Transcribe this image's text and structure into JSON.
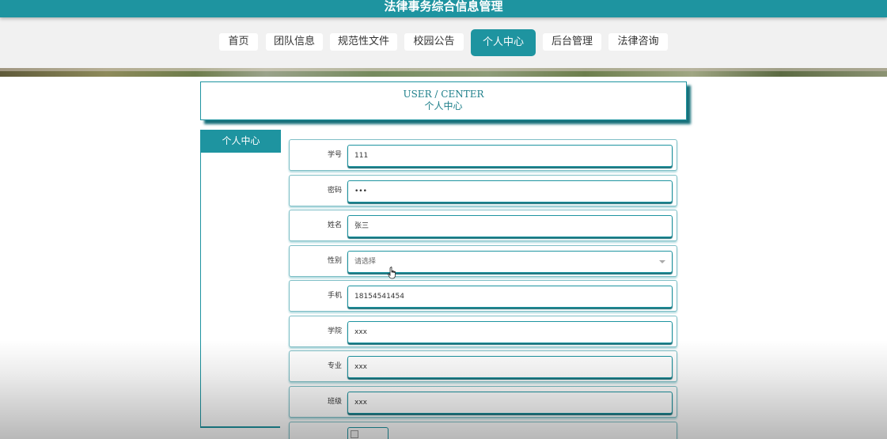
{
  "app": {
    "title": "法律事务综合信息管理"
  },
  "nav": {
    "items": [
      {
        "label": "首页"
      },
      {
        "label": "团队信息"
      },
      {
        "label": "规范性文件"
      },
      {
        "label": "校园公告"
      },
      {
        "label": "个人中心",
        "active": true
      },
      {
        "label": "后台管理"
      },
      {
        "label": "法律咨询"
      }
    ]
  },
  "page_header": {
    "title_en": "USER / CENTER",
    "title_cn": "个人中心"
  },
  "sidebar": {
    "items": [
      {
        "label": "个人中心"
      }
    ]
  },
  "form": {
    "fields": [
      {
        "label": "学号",
        "value": "111",
        "type": "text"
      },
      {
        "label": "密码",
        "value": "•••",
        "type": "password"
      },
      {
        "label": "姓名",
        "value": "张三",
        "type": "text"
      },
      {
        "label": "性别",
        "placeholder": "请选择",
        "type": "select"
      },
      {
        "label": "手机",
        "value": "18154541454",
        "type": "text"
      },
      {
        "label": "学院",
        "value": "xxx",
        "type": "text"
      },
      {
        "label": "专业",
        "value": "xxx",
        "type": "text"
      },
      {
        "label": "班级",
        "value": "xxx",
        "type": "text"
      },
      {
        "label": "",
        "type": "image"
      }
    ]
  },
  "colors": {
    "primary": "#1e94a0",
    "shadow": "#17707a",
    "nav_bg": "#f1f1f1"
  },
  "icons": {
    "cursor": "hand-pointer-icon",
    "select": "chevron-down-icon",
    "image": "broken-image-icon"
  }
}
